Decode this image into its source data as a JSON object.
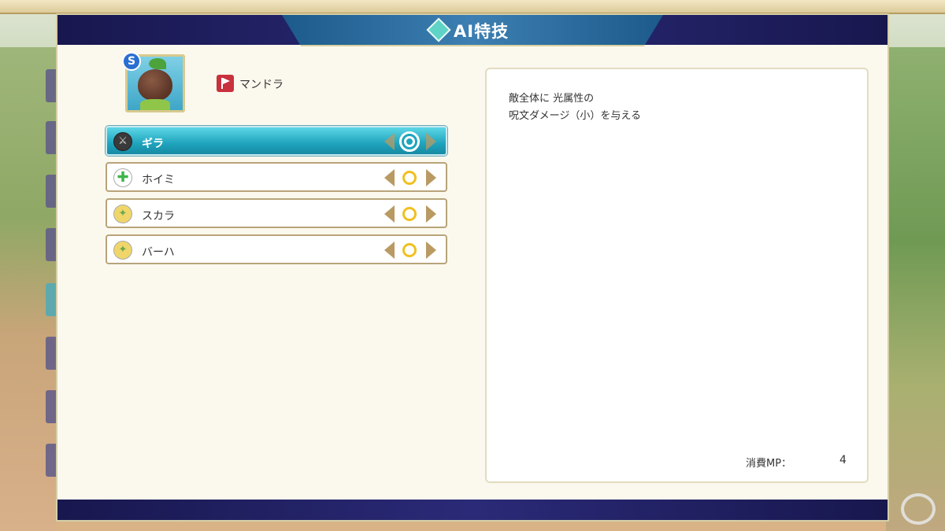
{
  "header": {
    "title": "AI特技"
  },
  "character": {
    "rank": "S",
    "name": "マンドラ"
  },
  "skills": [
    {
      "name": "ギラ",
      "icon": "sword-icon",
      "priority": "double-circle",
      "selected": true
    },
    {
      "name": "ホイミ",
      "icon": "heal-cross-icon",
      "priority": "circle",
      "selected": false
    },
    {
      "name": "スカラ",
      "icon": "buff-icon",
      "priority": "circle",
      "selected": false
    },
    {
      "name": "バーハ",
      "icon": "buff-icon",
      "priority": "circle",
      "selected": false
    }
  ],
  "description": {
    "line1": "敵全体に 光属性の",
    "line2": "呪文ダメージ（小）を与える",
    "mp_label": "消費MP：",
    "mp_value": "4"
  },
  "colors": {
    "header": "#1c1c5a",
    "selected_row": "#1fa4bd",
    "priority_circle": "#f0c020",
    "arrow": "#b99a63"
  }
}
